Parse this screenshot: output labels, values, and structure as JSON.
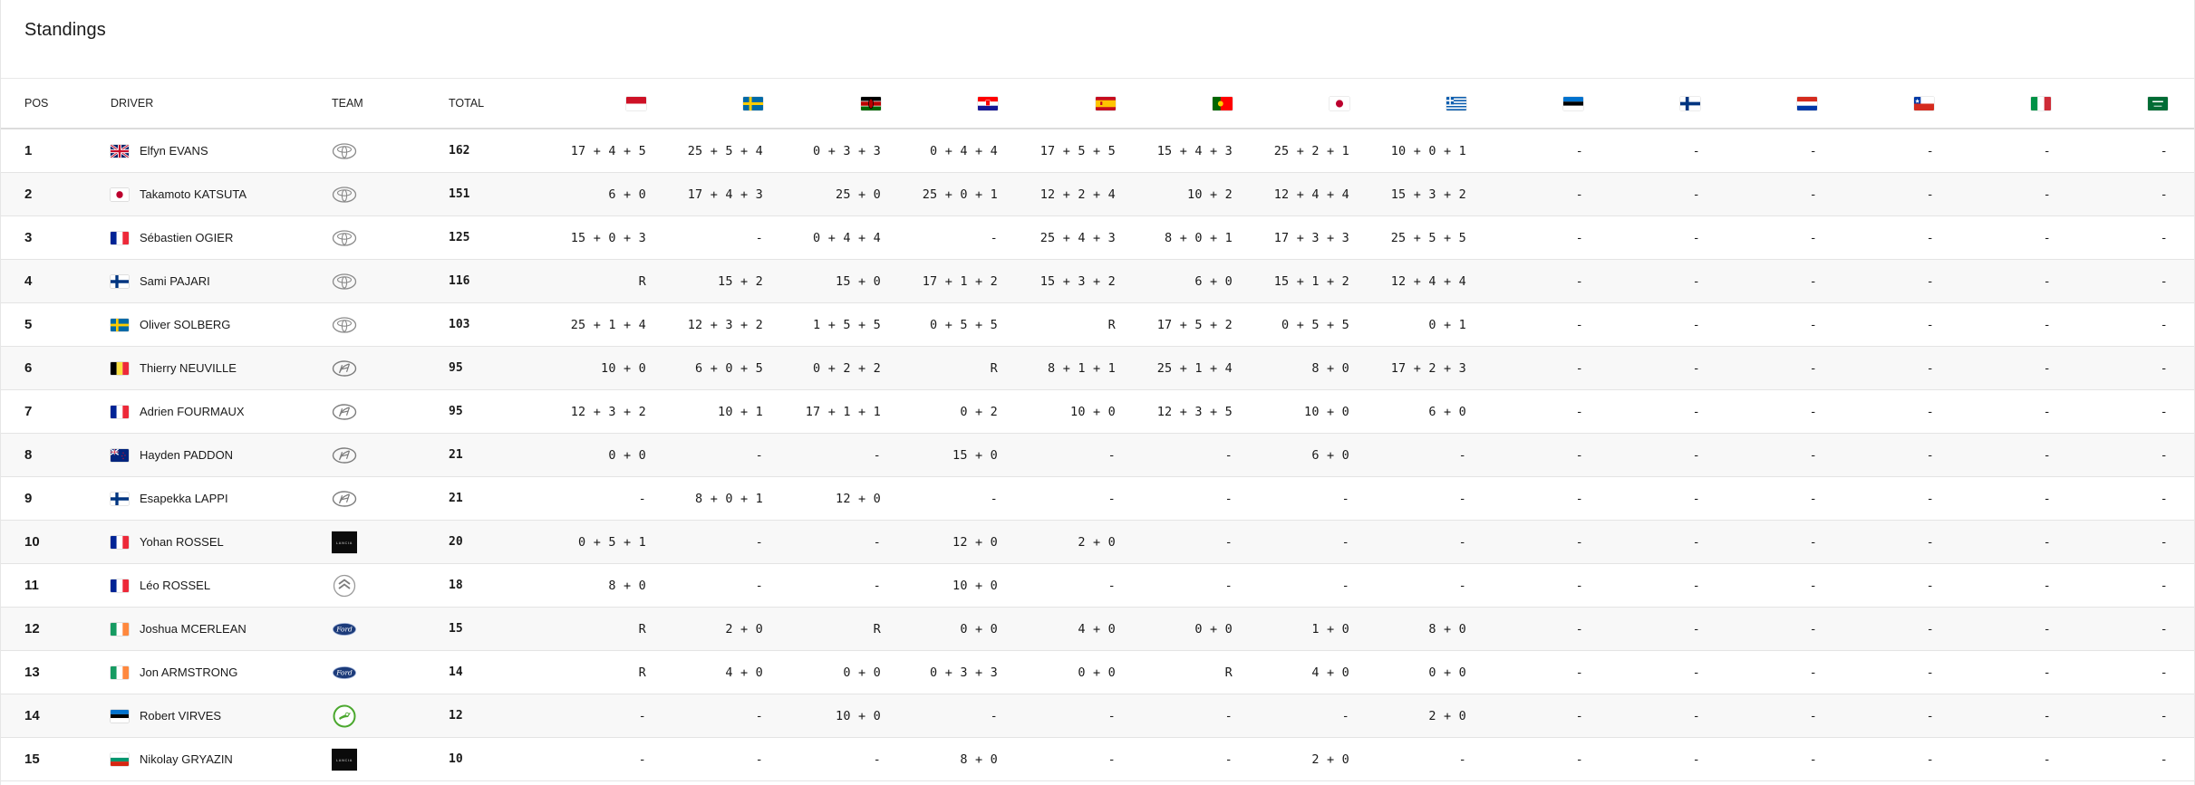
{
  "page_title": "Standings",
  "columns": {
    "pos": "POS",
    "driver": "DRIVER",
    "team": "TEAM",
    "total": "TOTAL",
    "rallies": [
      {
        "flag": "monaco-flag"
      },
      {
        "flag": "sweden-flag"
      },
      {
        "flag": "kenya-flag"
      },
      {
        "flag": "croatia-flag"
      },
      {
        "flag": "spain-flag"
      },
      {
        "flag": "portugal-flag"
      },
      {
        "flag": "japan-flag"
      },
      {
        "flag": "greece-flag"
      },
      {
        "flag": "estonia-flag"
      },
      {
        "flag": "finland-flag"
      },
      {
        "flag": "paraguay-flag"
      },
      {
        "flag": "chile-flag"
      },
      {
        "flag": "italy-flag"
      },
      {
        "flag": "saudi-arabia-flag"
      }
    ]
  },
  "rows": [
    {
      "pos": "1",
      "flag": "gb",
      "name": "Elfyn EVANS",
      "team": "toyota",
      "total": "162",
      "results": [
        "17 + 4 + 5",
        "25 + 5 + 4",
        "0 + 3 + 3",
        "0 + 4 + 4",
        "17 + 5 + 5",
        "15 + 4 + 3",
        "25 + 2 + 1",
        "10 + 0 + 1",
        "-",
        "-",
        "-",
        "-",
        "-",
        "-"
      ]
    },
    {
      "pos": "2",
      "flag": "jp",
      "name": "Takamoto KATSUTA",
      "team": "toyota",
      "total": "151",
      "results": [
        "6 + 0",
        "17 + 4 + 3",
        "25 + 0",
        "25 + 0 + 1",
        "12 + 2 + 4",
        "10 + 2",
        "12 + 4 + 4",
        "15 + 3 + 2",
        "-",
        "-",
        "-",
        "-",
        "-",
        "-"
      ]
    },
    {
      "pos": "3",
      "flag": "fr",
      "name": "Sébastien OGIER",
      "team": "toyota",
      "total": "125",
      "results": [
        "15 + 0 + 3",
        "-",
        "0 + 4 + 4",
        "-",
        "25 + 4 + 3",
        "8 + 0 + 1",
        "17 + 3 + 3",
        "25 + 5 + 5",
        "-",
        "-",
        "-",
        "-",
        "-",
        "-"
      ]
    },
    {
      "pos": "4",
      "flag": "fi",
      "name": "Sami PAJARI",
      "team": "toyota",
      "total": "116",
      "results": [
        "R",
        "15 + 2",
        "15 + 0",
        "17 + 1 + 2",
        "15 + 3 + 2",
        "6 + 0",
        "15 + 1 + 2",
        "12 + 4 + 4",
        "-",
        "-",
        "-",
        "-",
        "-",
        "-"
      ]
    },
    {
      "pos": "5",
      "flag": "se",
      "name": "Oliver SOLBERG",
      "team": "toyota",
      "total": "103",
      "results": [
        "25 + 1 + 4",
        "12 + 3 + 2",
        "1 + 5 + 5",
        "0 + 5 + 5",
        "R",
        "17 + 5 + 2",
        "0 + 5 + 5",
        "0 + 1",
        "-",
        "-",
        "-",
        "-",
        "-",
        "-"
      ]
    },
    {
      "pos": "6",
      "flag": "be",
      "name": "Thierry NEUVILLE",
      "team": "hyundai",
      "total": "95",
      "results": [
        "10 + 0",
        "6 + 0 + 5",
        "0 + 2 + 2",
        "R",
        "8 + 1 + 1",
        "25 + 1 + 4",
        "8 + 0",
        "17 + 2 + 3",
        "-",
        "-",
        "-",
        "-",
        "-",
        "-"
      ]
    },
    {
      "pos": "7",
      "flag": "fr",
      "name": "Adrien FOURMAUX",
      "team": "hyundai",
      "total": "95",
      "results": [
        "12 + 3 + 2",
        "10 + 1",
        "17 + 1 + 1",
        "0 + 2",
        "10 + 0",
        "12 + 3 + 5",
        "10 + 0",
        "6 + 0",
        "-",
        "-",
        "-",
        "-",
        "-",
        "-"
      ]
    },
    {
      "pos": "8",
      "flag": "nz",
      "name": "Hayden PADDON",
      "team": "hyundai",
      "total": "21",
      "results": [
        "0 + 0",
        "-",
        "-",
        "15 + 0",
        "-",
        "-",
        "6 + 0",
        "-",
        "-",
        "-",
        "-",
        "-",
        "-",
        "-"
      ]
    },
    {
      "pos": "9",
      "flag": "fi",
      "name": "Esapekka LAPPI",
      "team": "hyundai",
      "total": "21",
      "results": [
        "-",
        "8 + 0 + 1",
        "12 + 0",
        "-",
        "-",
        "-",
        "-",
        "-",
        "-",
        "-",
        "-",
        "-",
        "-",
        "-"
      ]
    },
    {
      "pos": "10",
      "flag": "fr",
      "name": "Yohan ROSSEL",
      "team": "lancia",
      "total": "20",
      "results": [
        "0 + 5 + 1",
        "-",
        "-",
        "12 + 0",
        "2 + 0",
        "-",
        "-",
        "-",
        "-",
        "-",
        "-",
        "-",
        "-",
        "-"
      ]
    },
    {
      "pos": "11",
      "flag": "fr",
      "name": "Léo ROSSEL",
      "team": "citroen",
      "total": "18",
      "results": [
        "8 + 0",
        "-",
        "-",
        "10 + 0",
        "-",
        "-",
        "-",
        "-",
        "-",
        "-",
        "-",
        "-",
        "-",
        "-"
      ]
    },
    {
      "pos": "12",
      "flag": "ie",
      "name": "Joshua MCERLEAN",
      "team": "ford",
      "total": "15",
      "results": [
        "R",
        "2 + 0",
        "R",
        "0 + 0",
        "4 + 0",
        "0 + 0",
        "1 + 0",
        "8 + 0",
        "-",
        "-",
        "-",
        "-",
        "-",
        "-"
      ]
    },
    {
      "pos": "13",
      "flag": "ie",
      "name": "Jon ARMSTRONG",
      "team": "ford",
      "total": "14",
      "results": [
        "R",
        "4 + 0",
        "0 + 0",
        "0 + 3 + 3",
        "0 + 0",
        "R",
        "4 + 0",
        "0 + 0",
        "-",
        "-",
        "-",
        "-",
        "-",
        "-"
      ]
    },
    {
      "pos": "14",
      "flag": "ee",
      "name": "Robert VIRVES",
      "team": "skoda",
      "total": "12",
      "results": [
        "-",
        "-",
        "10 + 0",
        "-",
        "-",
        "-",
        "-",
        "2 + 0",
        "-",
        "-",
        "-",
        "-",
        "-",
        "-"
      ]
    },
    {
      "pos": "15",
      "flag": "bg",
      "name": "Nikolay GRYAZIN",
      "team": "lancia",
      "total": "10",
      "results": [
        "-",
        "-",
        "-",
        "8 + 0",
        "-",
        "-",
        "2 + 0",
        "-",
        "-",
        "-",
        "-",
        "-",
        "-",
        "-"
      ]
    }
  ],
  "lancia_logo_text": "LANCIA"
}
